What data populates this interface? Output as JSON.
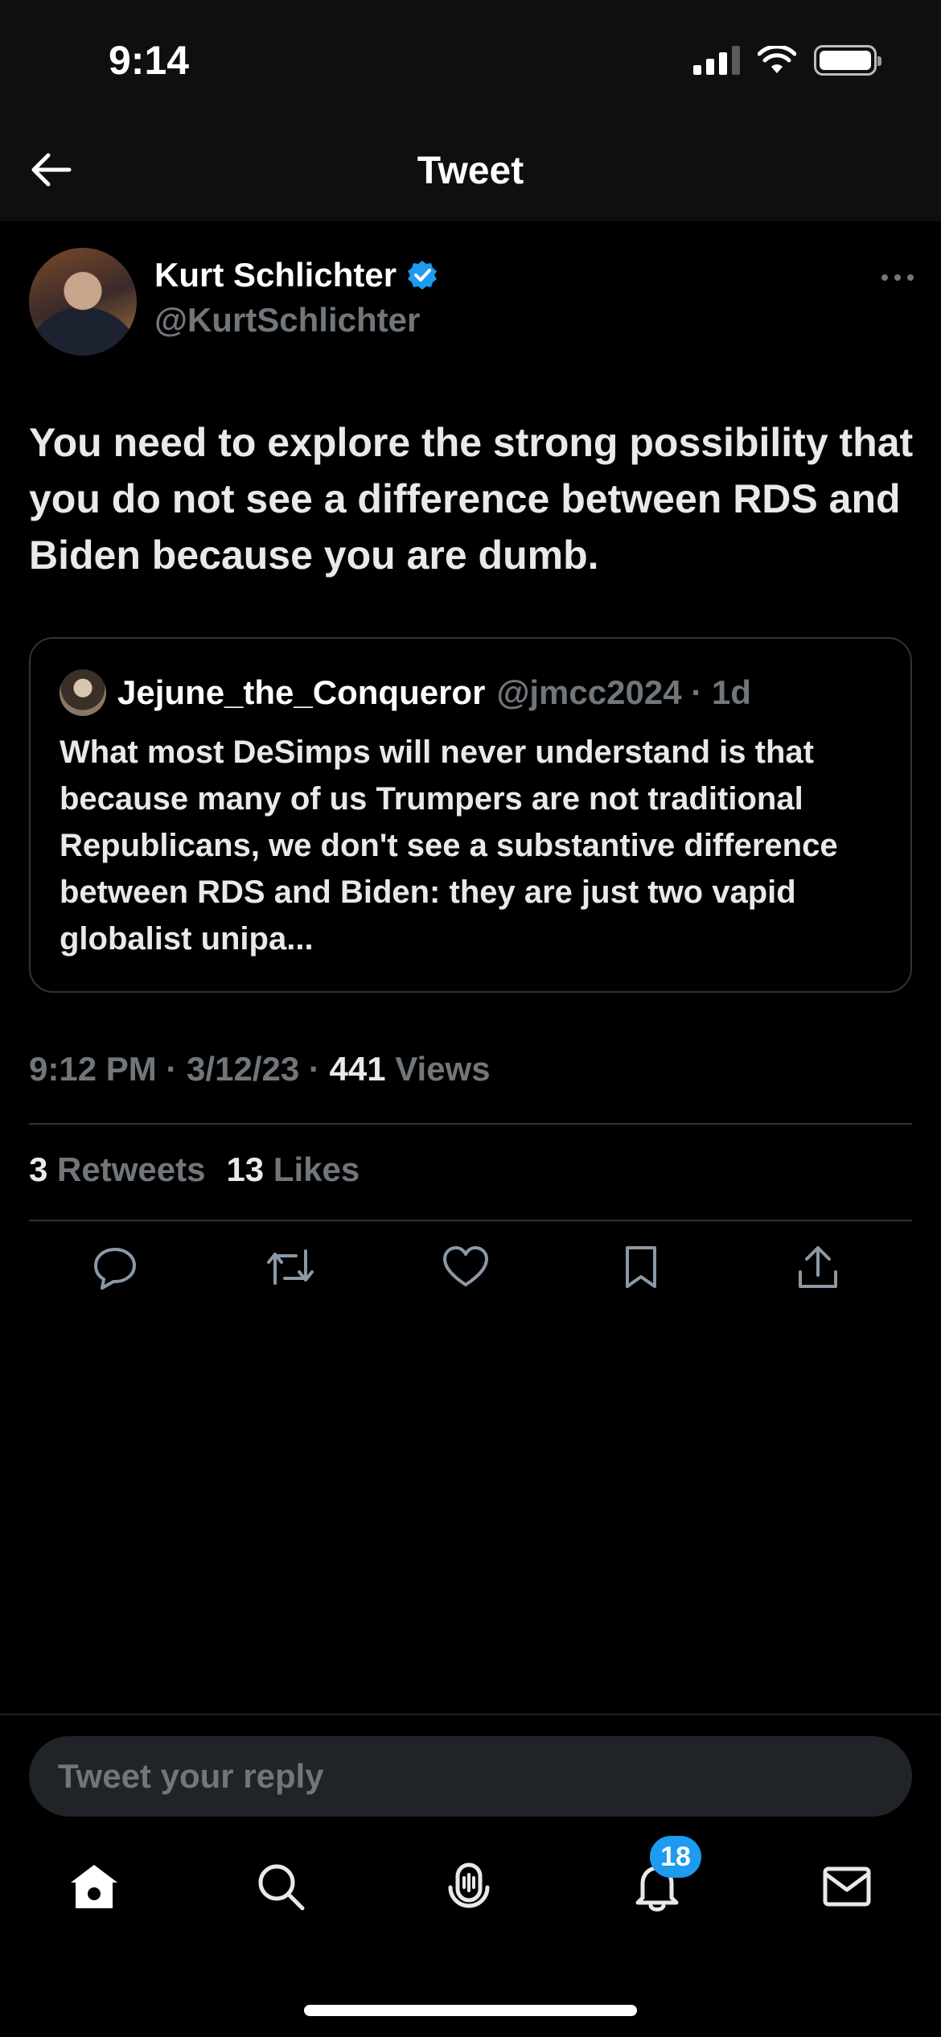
{
  "status_bar": {
    "time": "9:14"
  },
  "header": {
    "title": "Tweet"
  },
  "tweet": {
    "author_name": "Kurt Schlichter",
    "author_handle": "@KurtSchlichter",
    "text": "You need to explore the strong possibility that you do not see a difference between RDS and Biden because you are dumb.",
    "timestamp": "9:12 PM · 3/12/23 · ",
    "views_count": "441",
    "views_label": "Views",
    "retweets_count": "3",
    "retweets_label": "Retweets",
    "likes_count": "13",
    "likes_label": "Likes"
  },
  "quoted_tweet": {
    "name": "Jejune_the_Conqueror",
    "handle_time": "@jmcc2024 · 1d",
    "text": "What most DeSimps will never understand is that because many of us Trumpers are not traditional Republicans, we don't see a substantive difference between RDS and Biden: they are just two vapid globalist unipa..."
  },
  "reply": {
    "placeholder": "Tweet your reply"
  },
  "tabbar": {
    "notifications_badge": "18"
  },
  "icons": {
    "back": "arrow-left-icon",
    "verified": "verified-badge-icon",
    "more": "more-icon",
    "reply": "reply-icon",
    "retweet": "retweet-icon",
    "like": "heart-icon",
    "bookmark": "bookmark-icon",
    "share": "share-icon",
    "home": "home-icon",
    "search": "search-icon",
    "spaces": "spaces-icon",
    "notifications": "bell-icon",
    "messages": "mail-icon"
  },
  "colors": {
    "background": "#000000",
    "accent": "#1d9bf0",
    "muted": "#71767b",
    "text": "#e7e9ea"
  }
}
